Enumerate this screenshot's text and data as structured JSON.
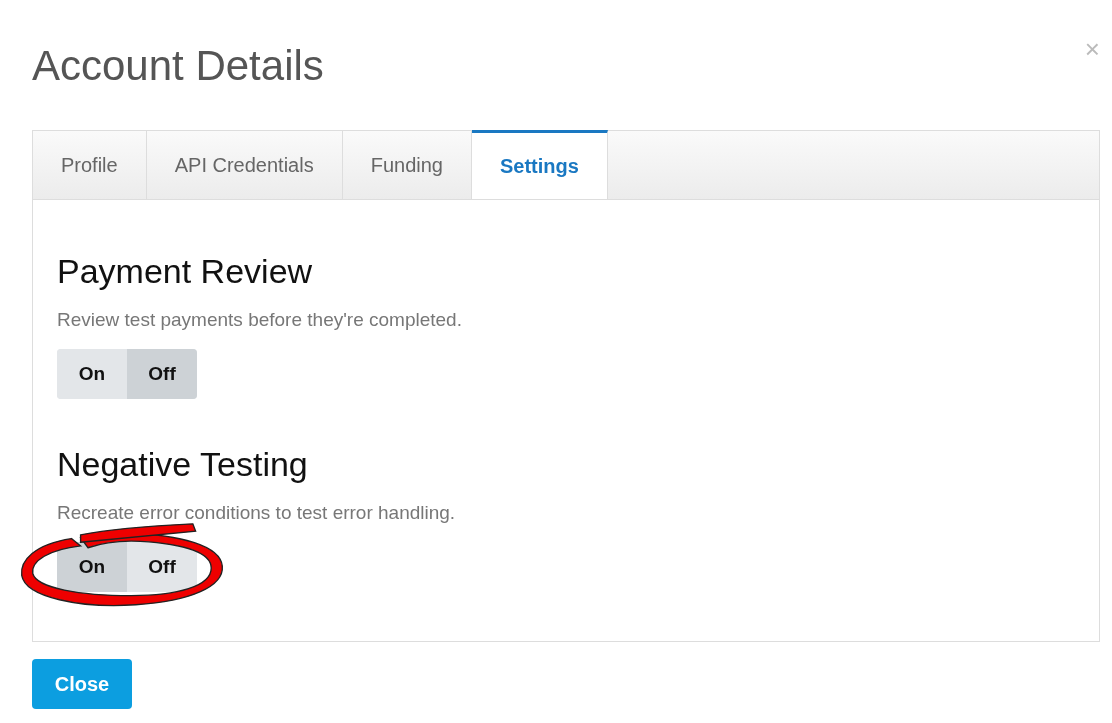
{
  "dialog": {
    "title": "Account Details",
    "close_icon": "×"
  },
  "tabs": [
    {
      "label": "Profile",
      "selected": false
    },
    {
      "label": "API Credentials",
      "selected": false
    },
    {
      "label": "Funding",
      "selected": false
    },
    {
      "label": "Settings",
      "selected": true
    }
  ],
  "settings": [
    {
      "title": "Payment Review",
      "description": "Review test payments before they're completed.",
      "options": [
        {
          "label": "On",
          "selected": false
        },
        {
          "label": "Off",
          "selected": true
        }
      ],
      "highlighted": false
    },
    {
      "title": "Negative Testing",
      "description": "Recreate error conditions to test error handling.",
      "options": [
        {
          "label": "On",
          "selected": true
        },
        {
          "label": "Off",
          "selected": false
        }
      ],
      "highlighted": true
    }
  ],
  "buttons": [
    {
      "label": "Close"
    }
  ]
}
